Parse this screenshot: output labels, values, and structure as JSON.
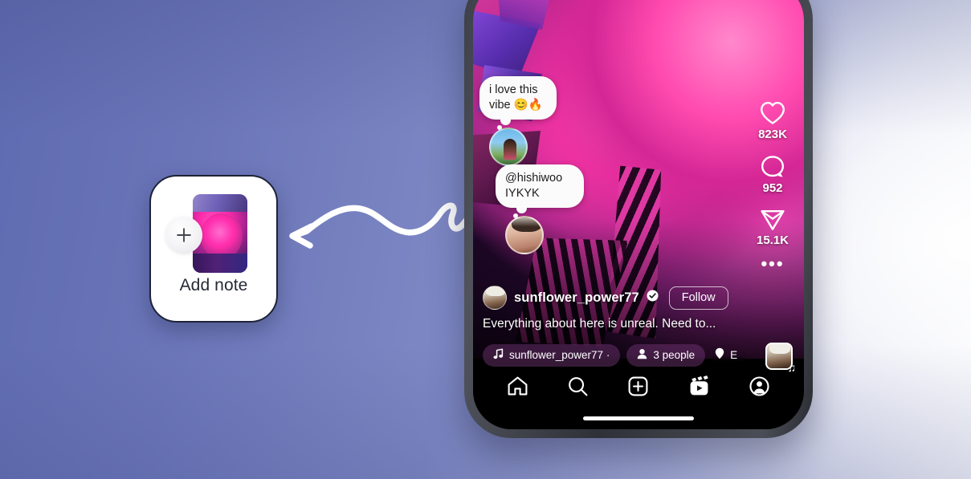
{
  "background": {
    "gradient_from": "#5f6bb0",
    "gradient_to": "#f4f5fa"
  },
  "note_card": {
    "label": "Add note",
    "plus_icon": "plus-icon",
    "thumbnail": "video-thumbnail"
  },
  "arrow": {
    "icon": "curved-arrow-pointing-left"
  },
  "phone": {
    "notes": [
      {
        "text": "i love this vibe 😊🔥",
        "avatar": "note-avatar-1"
      },
      {
        "text": "@hishiwoo IYKYK",
        "avatar": "note-avatar-2"
      }
    ],
    "rail": [
      {
        "icon": "heart-icon",
        "count": "823K"
      },
      {
        "icon": "comment-icon",
        "count": "952"
      },
      {
        "icon": "share-icon",
        "count": "15.1K"
      }
    ],
    "more_options": "•••",
    "post": {
      "username": "sunflower_power77",
      "verified_badge": "verified-icon",
      "follow_label": "Follow",
      "caption": "Everything about here is unreal. Need to..."
    },
    "pills": {
      "music": "sunflower_power77 ·",
      "music_icon": "music-note-icon",
      "people": "3 people",
      "people_icon": "person-icon",
      "location": "E",
      "location_icon": "location-pin-icon",
      "album_icon": "album-art"
    },
    "nav": [
      {
        "icon": "home-icon",
        "label": "Home"
      },
      {
        "icon": "search-icon",
        "label": "Search"
      },
      {
        "icon": "create-icon",
        "label": "Create"
      },
      {
        "icon": "reels-icon",
        "label": "Reels"
      },
      {
        "icon": "profile-icon",
        "label": "Profile"
      }
    ]
  }
}
